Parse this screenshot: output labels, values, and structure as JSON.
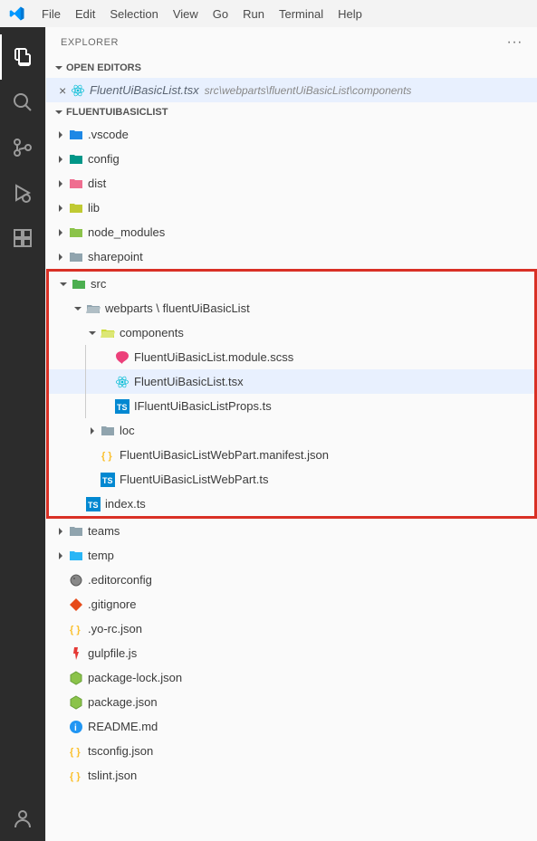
{
  "menu": {
    "file": "File",
    "edit": "Edit",
    "selection": "Selection",
    "view": "View",
    "go": "Go",
    "run": "Run",
    "terminal": "Terminal",
    "help": "Help"
  },
  "sidebar": {
    "title": "EXPLORER",
    "open_editors_label": "OPEN EDITORS",
    "project_label": "FLUENTUIBASICLIST"
  },
  "editor": {
    "name": "FluentUiBasicList.tsx",
    "path": "src\\webparts\\fluentUiBasicList\\components"
  },
  "tree": {
    "vscode": ".vscode",
    "config": "config",
    "dist": "dist",
    "lib": "lib",
    "node_modules": "node_modules",
    "sharepoint": "sharepoint",
    "src": "src",
    "webparts_path": "webparts \\ fluentUiBasicList",
    "components": "components",
    "scss": "FluentUiBasicList.module.scss",
    "tsx": "FluentUiBasicList.tsx",
    "props": "IFluentUiBasicListProps.ts",
    "loc": "loc",
    "manifest": "FluentUiBasicListWebPart.manifest.json",
    "webpart_ts": "FluentUiBasicListWebPart.ts",
    "index_ts": "index.ts",
    "teams": "teams",
    "temp": "temp",
    "editorconfig": ".editorconfig",
    "gitignore": ".gitignore",
    "yo_rc": ".yo-rc.json",
    "gulpfile": "gulpfile.js",
    "package_lock": "package-lock.json",
    "package": "package.json",
    "readme": "README.md",
    "tsconfig": "tsconfig.json",
    "tslint": "tslint.json"
  }
}
